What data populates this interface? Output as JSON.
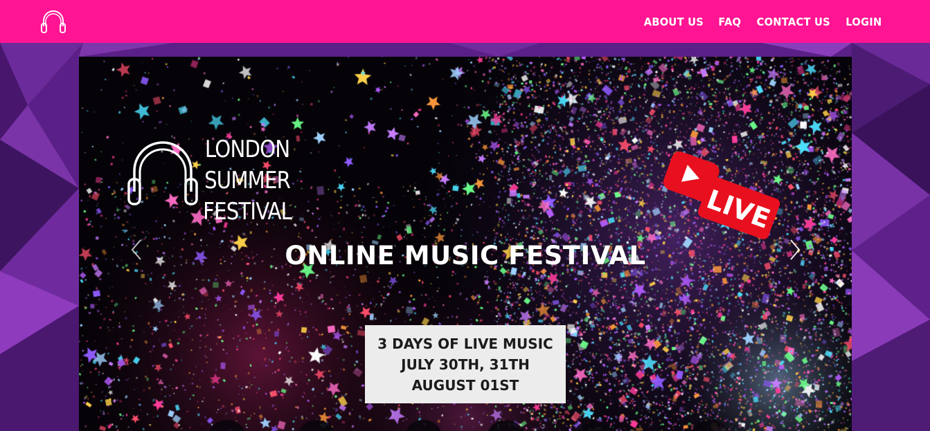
{
  "nav": {
    "logo_icon": "headphones-icon",
    "links": [
      "ABOUT US",
      "FAQ",
      "CONTACT US",
      "LOGIN"
    ]
  },
  "hero": {
    "logo_icon": "headphones-icon",
    "logo_lines": [
      "LONDON",
      "SUMMER",
      "FESTIVAL"
    ],
    "title": "ONLINE MUSIC FESTIVAL",
    "badge_text": "LIVE",
    "badge_icon": "play-icon",
    "info_lines": [
      "3 DAYS OF LIVE MUSIC",
      "JULY 30TH, 31TH",
      "AUGUST 01ST"
    ],
    "prev_icon": "chevron-left-icon",
    "next_icon": "chevron-right-icon"
  },
  "colors": {
    "navbar": "#ff1493",
    "page_background": "#5a1f86",
    "live_badge": "#e8101e",
    "info_box": "#ececec"
  }
}
